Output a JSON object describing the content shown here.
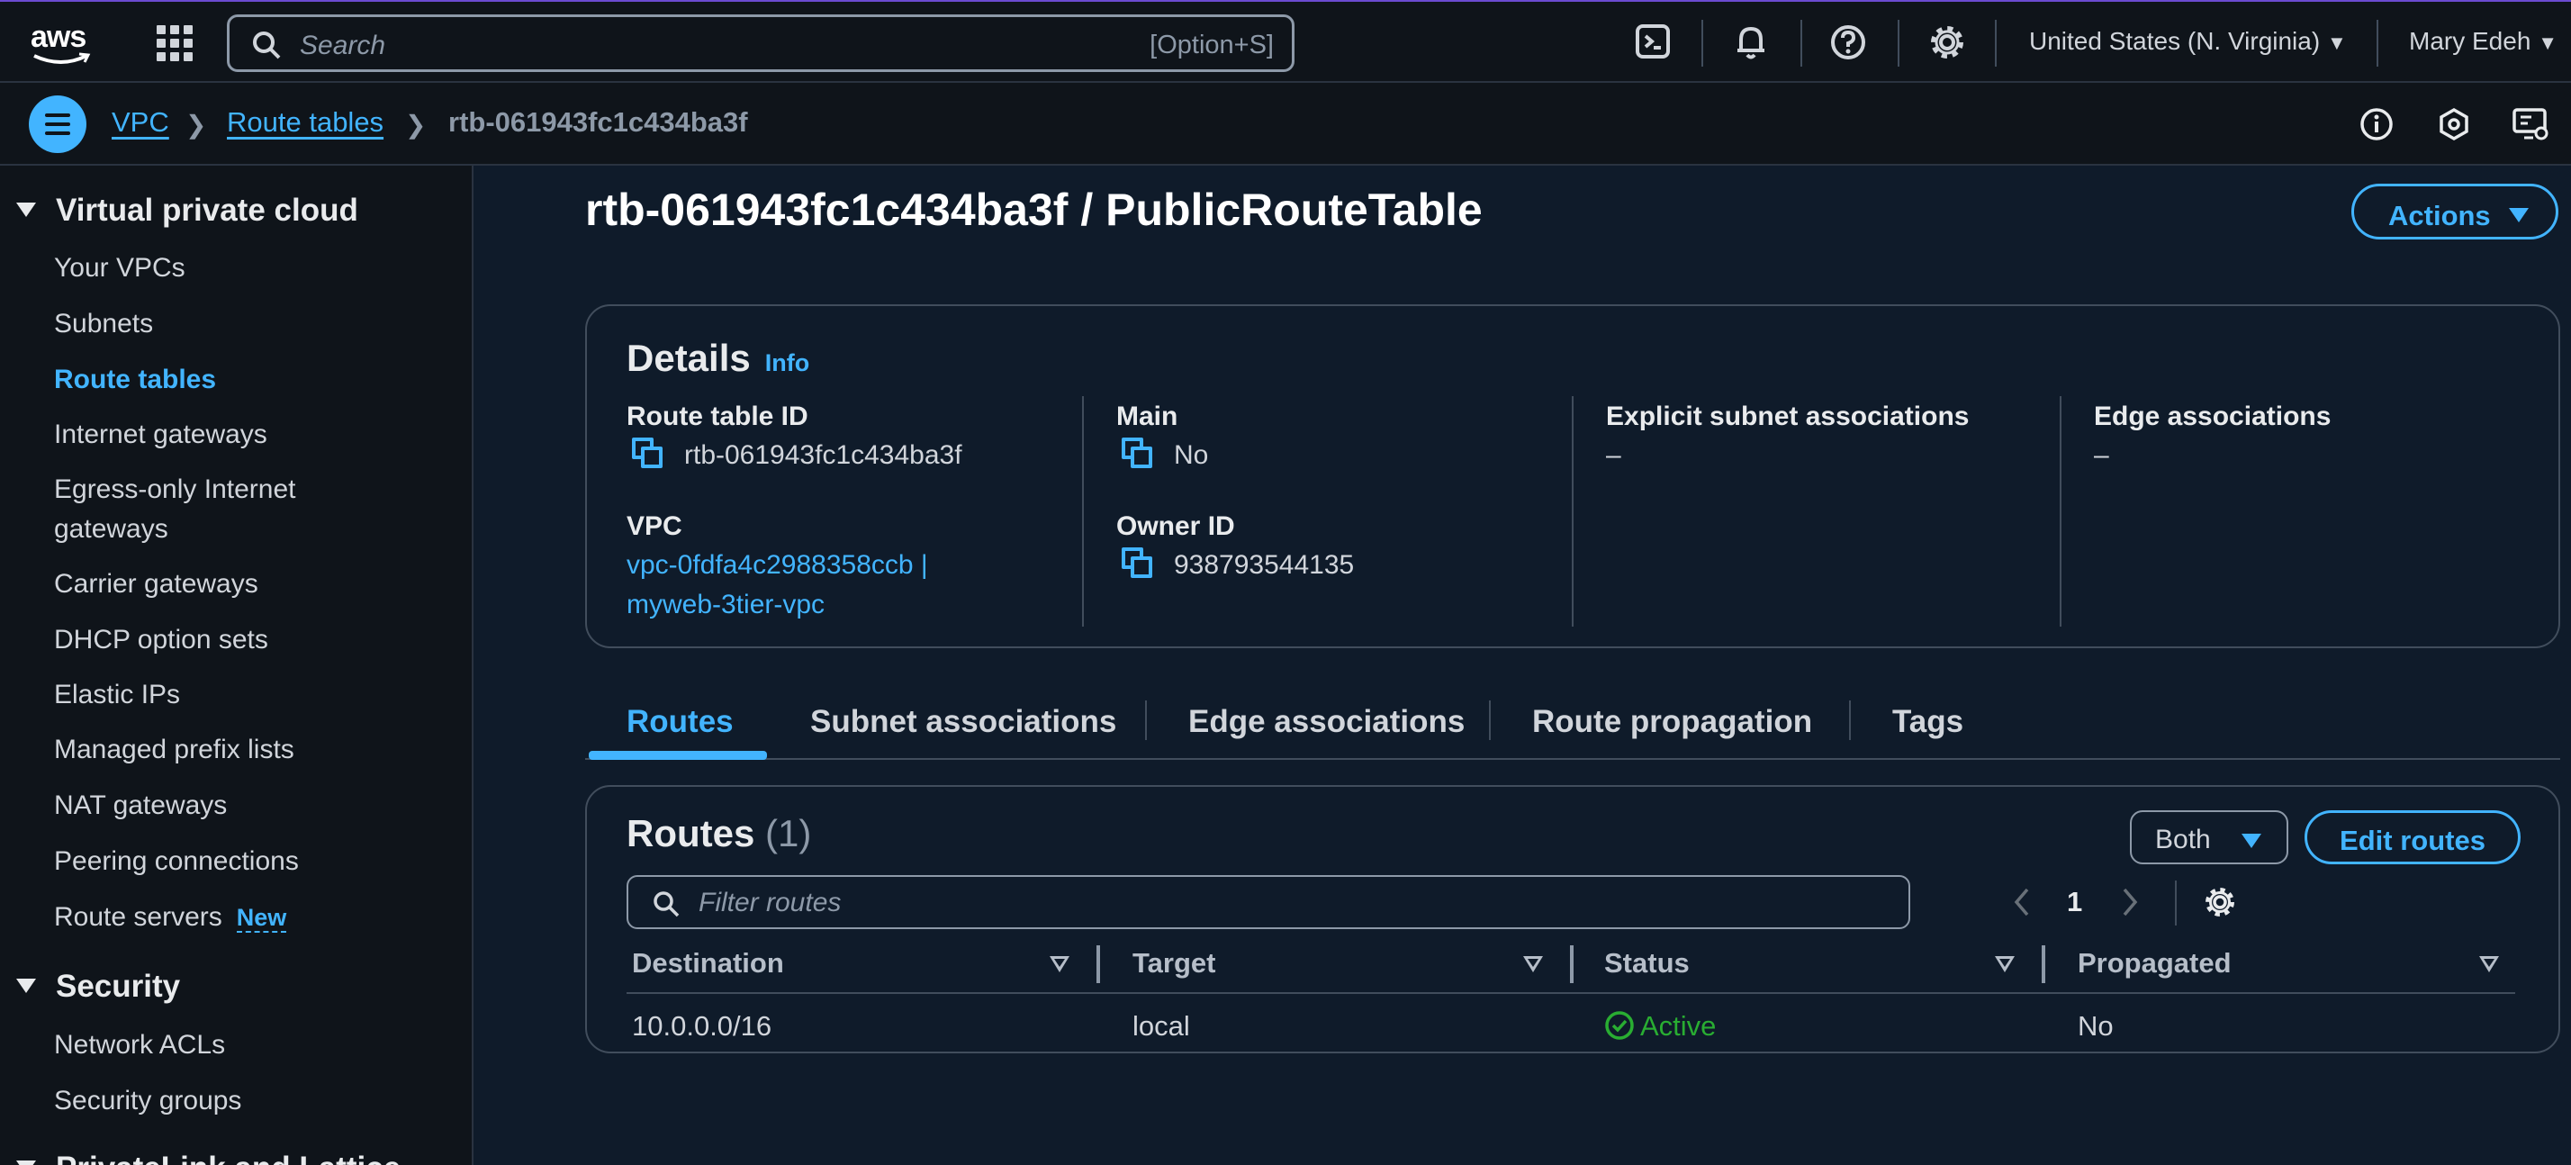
{
  "topbar": {
    "logo": "aws",
    "search_placeholder": "Search",
    "search_shortcut": "[Option+S]",
    "region": "United States (N. Virginia)",
    "user": "Mary Edeh",
    "icons": [
      "cloudshell-icon",
      "bell-icon",
      "help-icon",
      "settings-icon"
    ]
  },
  "breadcrumb": {
    "items": [
      "VPC",
      "Route tables",
      "rtb-061943fc1c434ba3f"
    ]
  },
  "sidebar": {
    "sections": [
      {
        "title": "Virtual private cloud",
        "items": [
          "Your VPCs",
          "Subnets",
          "Route tables",
          "Internet gateways",
          "Egress-only Internet gateways",
          "Carrier gateways",
          "DHCP option sets",
          "Elastic IPs",
          "Managed prefix lists",
          "NAT gateways",
          "Peering connections",
          "Route servers"
        ]
      },
      {
        "title": "Security",
        "items": [
          "Network ACLs",
          "Security groups"
        ]
      },
      {
        "title": "PrivateLink and Lattice"
      }
    ],
    "active_item": "Route tables",
    "new_badge": "New"
  },
  "page": {
    "title": "rtb-061943fc1c434ba3f / PublicRouteTable",
    "actions_label": "Actions"
  },
  "details": {
    "heading": "Details",
    "info": "Info",
    "route_table_id_label": "Route table ID",
    "route_table_id": "rtb-061943fc1c434ba3f",
    "main_label": "Main",
    "main": "No",
    "explicit_label": "Explicit subnet associations",
    "explicit": "–",
    "edge_label": "Edge associations",
    "edge": "–",
    "vpc_label": "VPC",
    "vpc_line1": "vpc-0fdfa4c2988358ccb |",
    "vpc_line2": "myweb-3tier-vpc",
    "owner_label": "Owner ID",
    "owner": "938793544135"
  },
  "tabs": [
    "Routes",
    "Subnet associations",
    "Edge associations",
    "Route propagation",
    "Tags"
  ],
  "routes": {
    "heading": "Routes",
    "count": "(1)",
    "both_label": "Both",
    "edit_label": "Edit routes",
    "filter_placeholder": "Filter routes",
    "page": "1",
    "columns": [
      "Destination",
      "Target",
      "Status",
      "Propagated"
    ],
    "rows": [
      {
        "destination": "10.0.0.0/16",
        "target": "local",
        "status": "Active",
        "propagated": "No"
      }
    ]
  },
  "colors": {
    "accent": "#42b4ff",
    "success": "#29ad32",
    "bg": "#0f1b2a"
  }
}
